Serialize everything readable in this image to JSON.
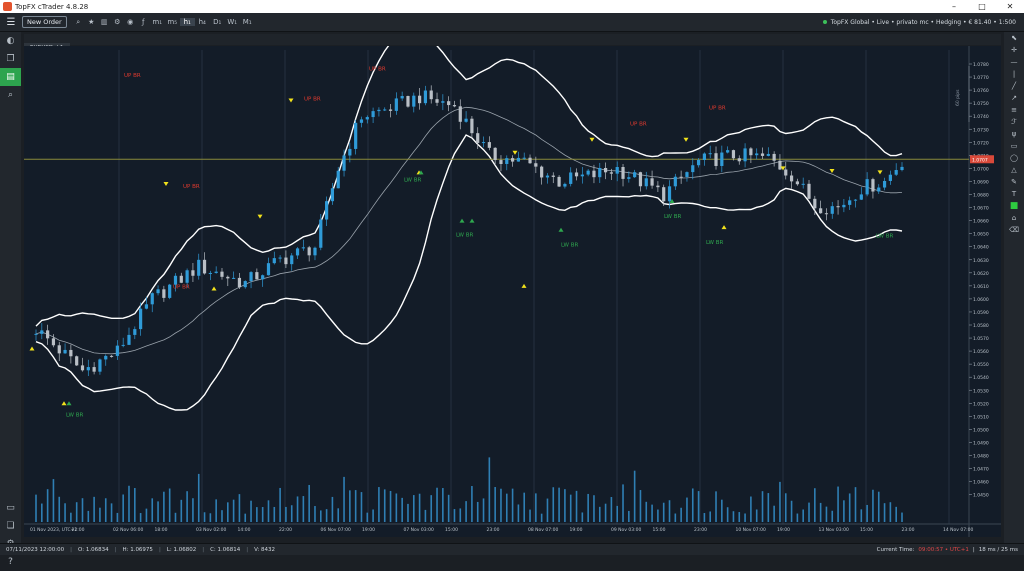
{
  "window": {
    "title": "TopFX cTrader 4.8.28"
  },
  "toolbar": {
    "new_order_label": "New Order",
    "timeframes": [
      "m₁",
      "m₅",
      "h₁",
      "h₄",
      "D₁",
      "W₁",
      "M₁"
    ],
    "account_status": "TopFX Global • Live • privato mc • Hedging • € 81.40 • 1:500"
  },
  "tab": {
    "label": "EURUSD, h1"
  },
  "chart": {
    "price_labels": [
      "1.0780",
      "1.0770",
      "1.0760",
      "1.0750",
      "1.0740",
      "1.0730",
      "1.0720",
      "1.0710",
      "1.0700",
      "1.0690",
      "1.0680",
      "1.0670",
      "1.0660",
      "1.0650",
      "1.0640",
      "1.0630",
      "1.0620",
      "1.0610",
      "1.0600",
      "1.0590",
      "1.0580",
      "1.0570",
      "1.0560",
      "1.0550",
      "1.0540",
      "1.0530",
      "1.0520",
      "1.0510",
      "1.0500",
      "1.0490",
      "1.0480",
      "1.0470",
      "1.0460",
      "1.0450"
    ],
    "current_price": "1.0707",
    "scale_label": "60 pips",
    "time_labels": [
      "01 Nov 2023, UTC+1",
      "22:00",
      "02 Nov 06:00",
      "18:00",
      "03 Nov 02:00",
      "14:00",
      "22:00",
      "06 Nov 07:00",
      "19:00",
      "07 Nov 03:00",
      "15:00",
      "23:00",
      "08 Nov 07:00",
      "19:00",
      "09 Nov 03:00",
      "15:00",
      "23:00",
      "10 Nov 07:00",
      "19:00",
      "13 Nov 03:00",
      "15:00",
      "23:00",
      "14 Nov 07:00"
    ],
    "up_label": "UP BR",
    "lw_label": "LW BR",
    "colors": {
      "bull": "#2f9bd8",
      "bear": "#b9bfc6",
      "band": "#ffffff",
      "up": "#e03a2f",
      "lw": "#2fa84f",
      "marker": "#f2e21b",
      "price_line": "#8a8a3a"
    }
  },
  "status": {
    "date": "07/11/2023 12:00:00",
    "open": "O: 1.06834",
    "high": "H: 1.06975",
    "low": "L: 1.06802",
    "close": "C: 1.06814",
    "volume": "V: 8432",
    "current_time_label": "Current Time:",
    "current_time_value": "09:00:57 • UTC+1",
    "latency": "18 ms / 25 ms"
  }
}
